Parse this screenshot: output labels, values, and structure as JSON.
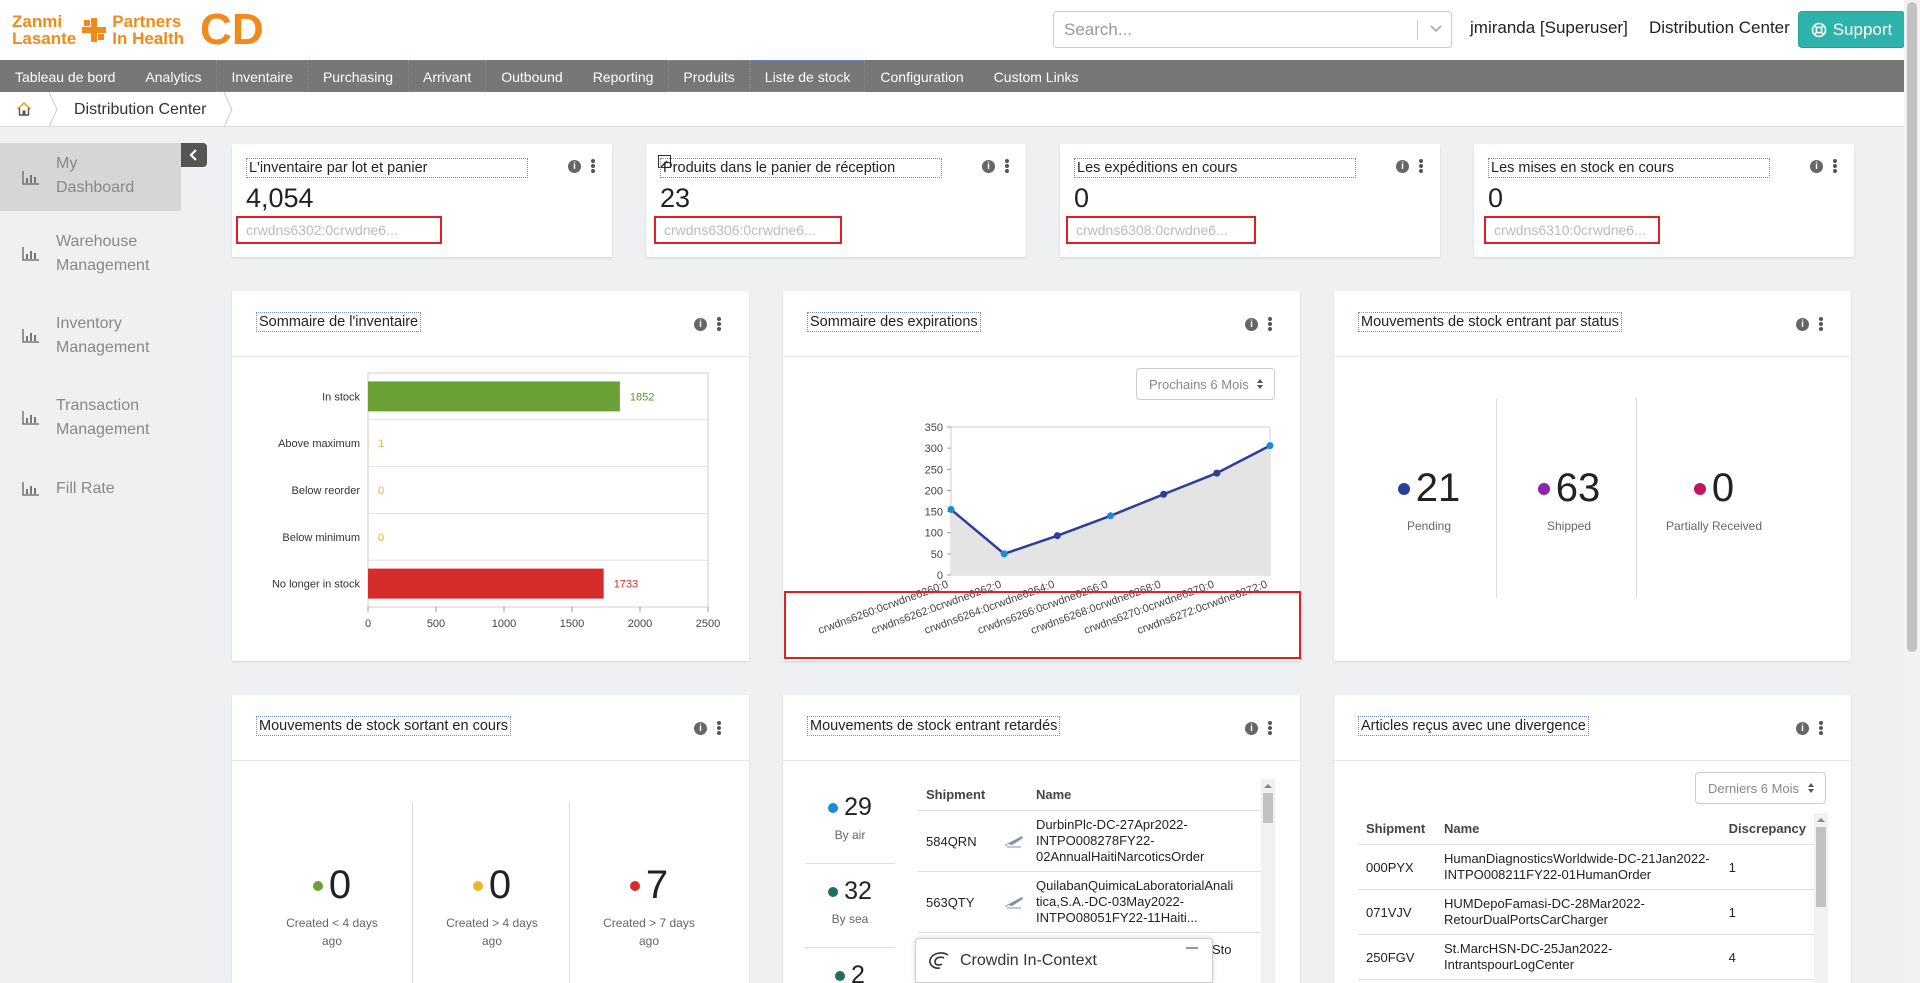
{
  "header": {
    "logo": {
      "line1": "Zanmi",
      "line1b": "Partners",
      "line2": "Lasante",
      "line2b": "In Health",
      "brand": "CD",
      "color": "#f08a1c"
    },
    "search": {
      "placeholder": "Search..."
    },
    "user": "jmiranda [Superuser]",
    "location": "Distribution Center",
    "support_label": "Support"
  },
  "menu": {
    "items": [
      {
        "label": "Tableau de bord"
      },
      {
        "label": "Analytics"
      },
      {
        "label": "Inventaire"
      },
      {
        "label": "Purchasing"
      },
      {
        "label": "Arrivant"
      },
      {
        "label": "Outbound"
      },
      {
        "label": "Reporting"
      },
      {
        "label": "Produits"
      },
      {
        "label": "Liste de stock"
      },
      {
        "label": "Configuration"
      },
      {
        "label": "Custom Links"
      }
    ]
  },
  "breadcrumb": {
    "location": "Distribution Center"
  },
  "sidebar": {
    "items": [
      {
        "label_1": "My",
        "label_2": "Dashboard",
        "icon": "bar-chart-icon",
        "active": true
      },
      {
        "label_1": "Warehouse",
        "label_2": "Management",
        "icon": "bar-chart-icon"
      },
      {
        "label_1": "Inventory",
        "label_2": "Management",
        "icon": "bar-chart-icon"
      },
      {
        "label_1": "Transaction",
        "label_2": "Management",
        "icon": "bar-chart-icon"
      },
      {
        "label_1": "Fill Rate",
        "label_2": "",
        "icon": "bar-chart-icon"
      }
    ]
  },
  "kpis": [
    {
      "title": "L'inventaire par lot et panier",
      "value": "4,054",
      "link": "crwdns6302:0crwdne6..."
    },
    {
      "title": "Produits dans le panier de réception",
      "value": "23",
      "link": "crwdns6306:0crwdne6..."
    },
    {
      "title": "Les expéditions en cours",
      "value": "0",
      "link": "crwdns6308:0crwdne6..."
    },
    {
      "title": "Les mises en stock en cours",
      "value": "0",
      "link": "crwdns6310:0crwdne6..."
    }
  ],
  "inventory_summary": {
    "title": "Sommaire de l'inventaire",
    "chart_data": {
      "type": "bar",
      "orientation": "horizontal",
      "categories": [
        "In stock",
        "Above maximum",
        "Below reorder",
        "Below minimum",
        "No longer in stock"
      ],
      "values": [
        1852,
        1,
        0,
        0,
        1733
      ],
      "colors": [
        "#6aa135",
        "#f0b429",
        "#f0b429",
        "#f0b429",
        "#d62c2c"
      ],
      "label_colors": [
        "#5a9a2a",
        "#f0b429",
        "#f0b429",
        "#f0b429",
        "#d62c2c"
      ],
      "xlim": [
        0,
        2500
      ],
      "xticks": [
        0,
        500,
        1000,
        1500,
        2000,
        2500
      ]
    }
  },
  "expiry_summary": {
    "title": "Sommaire des expirations",
    "period": "Prochains 6 Mois",
    "chart_data": {
      "type": "line",
      "categories": [
        "crwdns6260:0crwdne6260:0",
        "crwdns6262:0crwdne6262:0",
        "crwdns6264:0crwdne6264:0",
        "crwdns6266:0crwdne6266:0",
        "crwdns6268:0crwdne6268:0",
        "crwdns6270:0crwdne6270:0",
        "crwdns6272:0crwdne6272:0"
      ],
      "values": [
        155,
        50,
        93,
        140,
        191,
        241,
        306
      ],
      "point_colors": [
        "#1a8ad4",
        "#1a8ad4",
        "#2b3e9a",
        "#1a8ad4",
        "#2b3e9a",
        "#2b3e9a",
        "#1a8ad4"
      ],
      "line_color": "#2b3e9a",
      "ylim": [
        0,
        350
      ],
      "yticks": [
        0,
        50,
        100,
        150,
        200,
        250,
        300,
        350
      ]
    }
  },
  "inbound_status": {
    "title": "Mouvements de stock entrant par status",
    "stats": [
      {
        "value": "21",
        "label": "Pending",
        "color": "#2b3e9a"
      },
      {
        "value": "63",
        "label": "Shipped",
        "color": "#8e24aa"
      },
      {
        "value": "0",
        "label": "Partially Received",
        "color": "#c2185b"
      }
    ]
  },
  "outbound_pending": {
    "title": "Mouvements de stock sortant en cours",
    "stats": [
      {
        "value": "0",
        "label_1": "Created < 4 days",
        "label_2": "ago",
        "color": "#6aa135"
      },
      {
        "value": "0",
        "label_1": "Created > 4 days",
        "label_2": "ago",
        "color": "#f0b429"
      },
      {
        "value": "7",
        "label_1": "Created > 7 days",
        "label_2": "ago",
        "color": "#d62c2c"
      }
    ]
  },
  "delayed_inbound": {
    "title": "Mouvements de stock entrant retardés",
    "stats": [
      {
        "value": "29",
        "label": "By air",
        "color": "#1a8ad4"
      },
      {
        "value": "32",
        "label": "By sea",
        "color": "#1f6f5c"
      },
      {
        "value": "2",
        "label": "",
        "color": "#1f6f5c"
      }
    ],
    "columns": [
      "Shipment",
      "Name"
    ],
    "rows": [
      {
        "shipment": "584QRN",
        "name_1": "DurbinPlc-DC-27Apr2022-",
        "name_2": "INTPO008278FY22-",
        "name_3": "02AnnualHaitiNarcoticsOrder"
      },
      {
        "shipment": "563QTY",
        "name_1": "QuilabanQuimicaLaboratorialAnali",
        "name_2": "tica,S.A.-DC-03May2022-",
        "name_3": "INTPO08051FY22-11Haiti..."
      }
    ]
  },
  "discrepancy": {
    "title": "Articles reçus avec une divergence",
    "period": "Derniers 6 Mois",
    "columns": [
      "Shipment",
      "Name",
      "Discrepancy"
    ],
    "rows": [
      {
        "shipment": "000PYX",
        "name_1": "HumanDiagnosticsWorldwide-DC-21Jan2022-",
        "name_2": "INTPO008211FY22-01HumanOrder",
        "discrepancy": "1"
      },
      {
        "shipment": "071VJV",
        "name_1": "HUMDepoFamasi-DC-28Mar2022-",
        "name_2": "RetourDualPortsCarCharger",
        "discrepancy": "1"
      },
      {
        "shipment": "250FGV",
        "name_1": "St.MarcHSN-DC-25Jan2022-",
        "name_2": "IntrantspourLogCenter",
        "discrepancy": "4"
      }
    ]
  },
  "crowdin": {
    "label": "Crowdin In-Context",
    "peek": "Sto"
  }
}
